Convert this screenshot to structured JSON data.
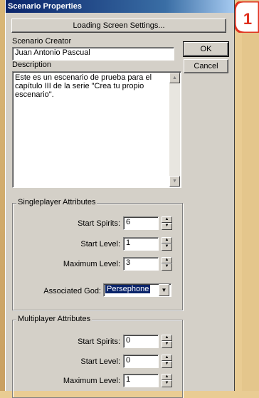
{
  "window": {
    "title": "Scenario Properties"
  },
  "callout": {
    "number": "1"
  },
  "loading_button": {
    "label": "Loading Screen Settings..."
  },
  "ok_button": {
    "label": "OK"
  },
  "cancel_button": {
    "label": "Cancel"
  },
  "creator": {
    "label": "Scenario Creator",
    "value": "Juan Antonio Pascual"
  },
  "description": {
    "label": "Description",
    "line1": "Este es un escenario de prueba para el",
    "line2": "capítulo III de la serie \"Crea tu propio",
    "line3": "escenario\"."
  },
  "singleplayer": {
    "title": "Singleplayer Attributes",
    "start_spirits_label": "Start Spirits:",
    "start_spirits": "6",
    "start_level_label": "Start Level:",
    "start_level": "1",
    "max_level_label": "Maximum Level:",
    "max_level": "3",
    "god_label": "Associated God:",
    "god_value": "Persephone"
  },
  "multiplayer": {
    "title": "Multiplayer Attributes",
    "start_spirits_label": "Start Spirits:",
    "start_spirits": "0",
    "start_level_label": "Start Level:",
    "start_level": "0",
    "max_level_label": "Maximum Level:",
    "max_level": "1"
  },
  "colors": {
    "titlebar": "#0a246a",
    "dialog": "#d4d0c8",
    "callout": "#e0301e",
    "page_bg": "#e9cc93"
  },
  "icons": {
    "scroll_up": "triangle-up",
    "scroll_down": "triangle-down",
    "spin": "up-down-arrows",
    "combo": "triangle-down"
  }
}
